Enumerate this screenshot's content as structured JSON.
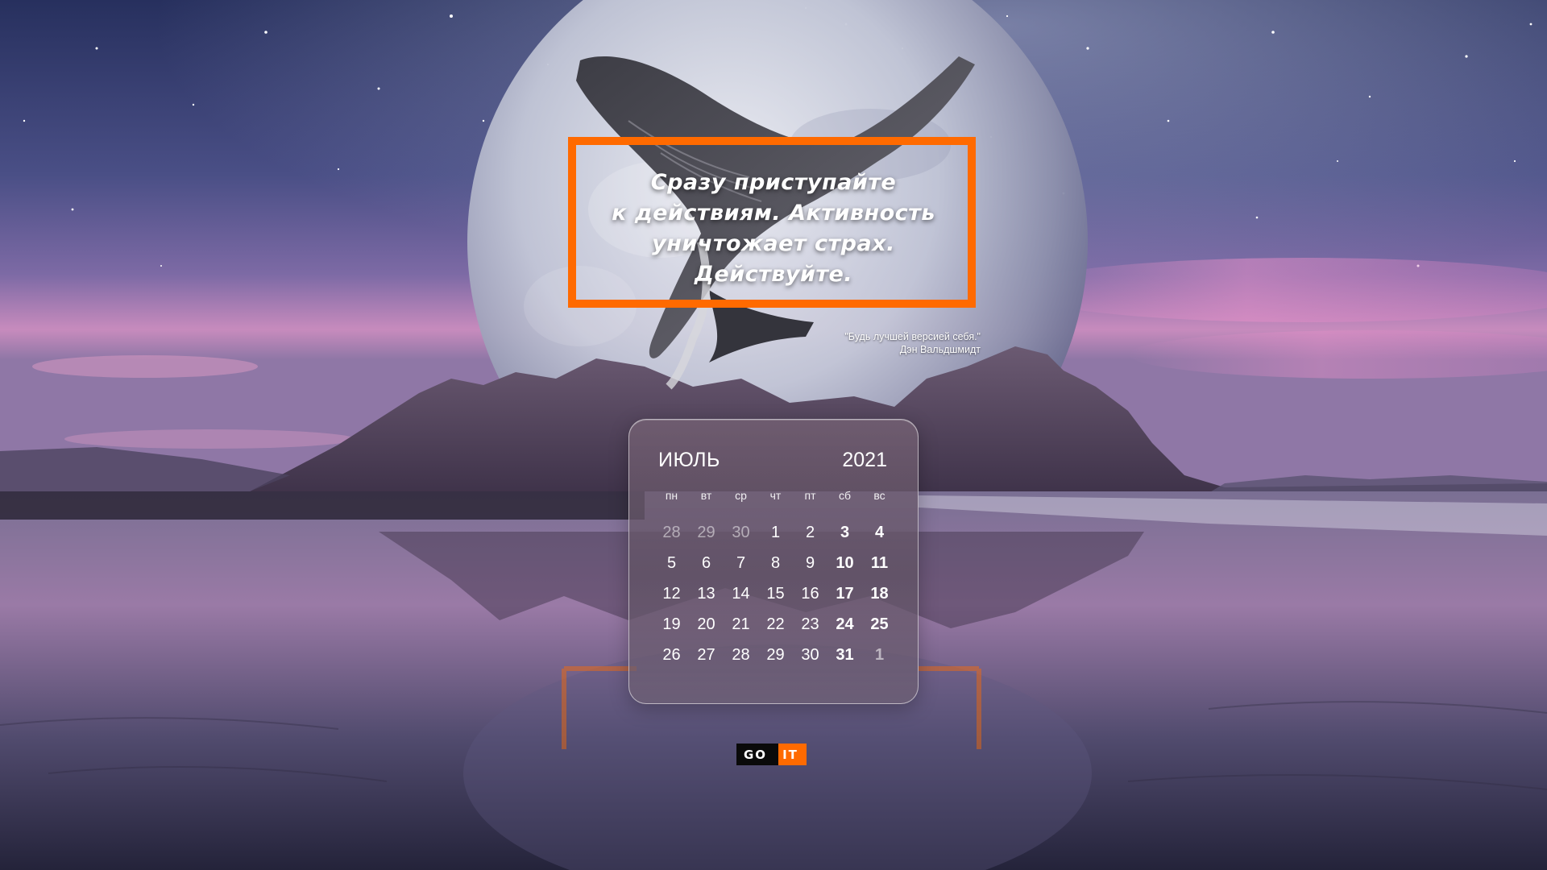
{
  "quote": {
    "lines": [
      "Сразу приступайте",
      "к действиям. Активность",
      "уничтожает страх.",
      "Действуйте."
    ]
  },
  "motto": {
    "text": "\"Будь лучшей версией себя.\"",
    "author": "Дэн Вальдшмидт"
  },
  "calendar": {
    "month": "ИЮЛЬ",
    "year": "2021",
    "weekdays": [
      "пн",
      "вт",
      "ср",
      "чт",
      "пт",
      "сб",
      "вс"
    ],
    "weeks": [
      [
        "28",
        "29",
        "30",
        "1",
        "2",
        "3",
        "4"
      ],
      [
        "5",
        "6",
        "7",
        "8",
        "9",
        "10",
        "11"
      ],
      [
        "12",
        "13",
        "14",
        "15",
        "16",
        "17",
        "18"
      ],
      [
        "19",
        "20",
        "21",
        "22",
        "23",
        "24",
        "25"
      ],
      [
        "26",
        "27",
        "28",
        "29",
        "30",
        "31",
        "1"
      ]
    ],
    "muted_cells": [
      "0.0",
      "0.1",
      "0.2",
      "4.6"
    ]
  },
  "logo": {
    "go": "GO",
    "it": "IT"
  },
  "colors": {
    "accent": "#ff6a00",
    "sky_top": "#2b3566",
    "sky_horizon": "#c58ac0"
  },
  "icons": {
    "background": "whale-moon-beach-illustration"
  }
}
